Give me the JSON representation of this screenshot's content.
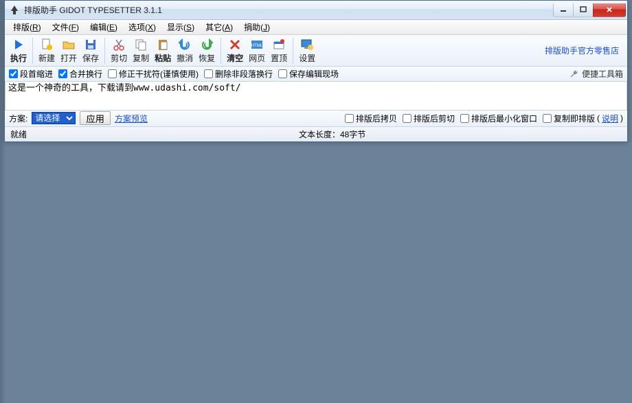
{
  "titlebar": {
    "title": "排版助手 GIDOT TYPESETTER 3.1.1"
  },
  "menu": {
    "items": [
      {
        "label": "排版",
        "key": "R"
      },
      {
        "label": "文件",
        "key": "F"
      },
      {
        "label": "编辑",
        "key": "E"
      },
      {
        "label": "选项",
        "key": "X"
      },
      {
        "label": "显示",
        "key": "S"
      },
      {
        "label": "其它",
        "key": "A"
      },
      {
        "label": "捐助",
        "key": "J"
      }
    ]
  },
  "toolbar": {
    "run": "执行",
    "new": "新建",
    "open": "打开",
    "save": "保存",
    "cut": "剪切",
    "copy": "复制",
    "paste": "粘贴",
    "undo": "撤消",
    "redo": "恢复",
    "clear": "清空",
    "web": "网页",
    "top": "置顶",
    "settings": "设置",
    "store_link": "排版助手官方零售店"
  },
  "options": {
    "indent": {
      "label": "段首缩进",
      "checked": true
    },
    "merge": {
      "label": "合并换行",
      "checked": true
    },
    "fix": {
      "label": "修正干扰符(谨慎使用)",
      "checked": false
    },
    "del": {
      "label": "删除非段落换行",
      "checked": false
    },
    "savescene": {
      "label": "保存编辑现场",
      "checked": false
    },
    "toolbox": "便捷工具箱"
  },
  "editor": {
    "content": "这是一个神奇的工具，下载请到www.udashi.com/soft/"
  },
  "bottom": {
    "scheme_label": "方案:",
    "scheme_selected": "请选择",
    "apply": "应用",
    "preview": "方案预览",
    "after_copy": {
      "label": "排版后拷贝",
      "checked": false
    },
    "after_cut": {
      "label": "排版后剪切",
      "checked": false
    },
    "after_min": {
      "label": "排版后最小化窗口",
      "checked": false
    },
    "copy_typeset": {
      "label": "复制即排版",
      "checked": false
    },
    "explain": "说明"
  },
  "status": {
    "ready": "就绪",
    "length": "文本长度：48字节"
  }
}
